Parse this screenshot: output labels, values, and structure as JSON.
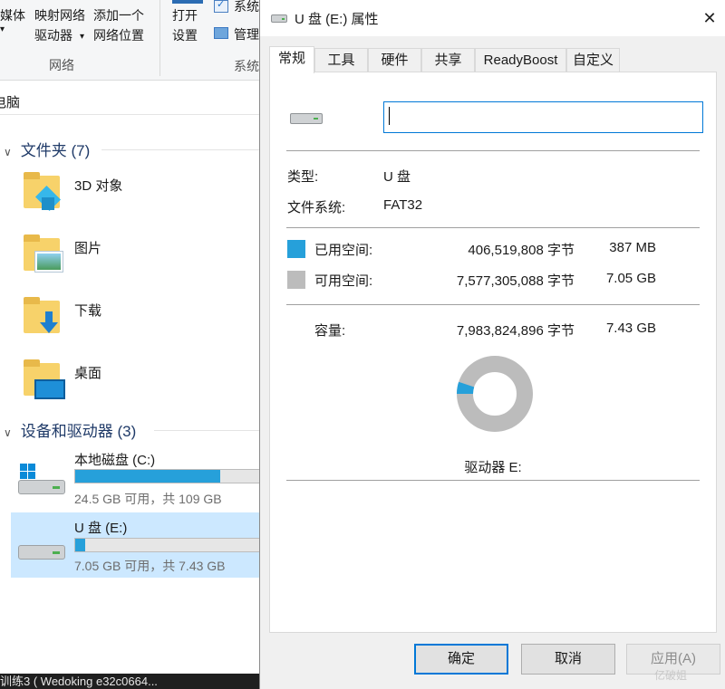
{
  "explorer": {
    "ribbon": {
      "media_label": "媒体",
      "map_drive_line1": "映射网络",
      "map_drive_line2": "驱动器",
      "add_location_line1": "添加一个",
      "add_location_line2": "网络位置",
      "open_settings_line1": "打开",
      "open_settings_line2": "设置",
      "system_label": "系统",
      "manage_label": "管理",
      "group_network": "网络",
      "group_system": "系统"
    },
    "address_text": "电脑",
    "folders_header": "文件夹 (7)",
    "folders": [
      {
        "label": "3D 对象",
        "icon": "3d-objects-folder-icon"
      },
      {
        "label": "图片",
        "icon": "pictures-folder-icon"
      },
      {
        "label": "下载",
        "icon": "downloads-folder-icon"
      },
      {
        "label": "桌面",
        "icon": "desktop-folder-icon"
      }
    ],
    "devices_header": "设备和驱动器 (3)",
    "drives": [
      {
        "name": "本地磁盘 (C:)",
        "free_text": "24.5 GB 可用，共 109 GB",
        "used_fraction": 0.775,
        "icon": "windows-drive-icon"
      },
      {
        "name": "U 盘 (E:)",
        "free_text": "7.05 GB 可用，共 7.43 GB",
        "used_fraction": 0.051,
        "icon": "usb-drive-icon"
      }
    ],
    "taskbar_text": "训练3 (   Wedoking   e32c0664..."
  },
  "dialog": {
    "title": "U 盘 (E:) 属性",
    "close_label": "✕",
    "tabs": [
      {
        "label": "常规",
        "active": true
      },
      {
        "label": "工具",
        "active": false
      },
      {
        "label": "硬件",
        "active": false
      },
      {
        "label": "共享",
        "active": false
      },
      {
        "label": "ReadyBoost",
        "active": false
      },
      {
        "label": "自定义",
        "active": false
      }
    ],
    "name_input_value": "",
    "type_label": "类型:",
    "type_value": "U 盘",
    "fs_label": "文件系统:",
    "fs_value": "FAT32",
    "used_label": "已用空间:",
    "used_bytes": "406,519,808 字节",
    "used_size": "387 MB",
    "free_label": "可用空间:",
    "free_bytes": "7,577,305,088 字节",
    "free_size": "7.05 GB",
    "capacity_label": "容量:",
    "capacity_bytes": "7,983,824,896 字节",
    "capacity_size": "7.43 GB",
    "used_fraction": 0.0509,
    "drive_label": "驱动器 E:",
    "ok_label": "确定",
    "cancel_label": "取消",
    "apply_label": "应用(A)",
    "colors": {
      "used": "#26a0da",
      "free": "#bcbcbc",
      "accent": "#0078d7"
    }
  },
  "watermark": "亿破姐"
}
